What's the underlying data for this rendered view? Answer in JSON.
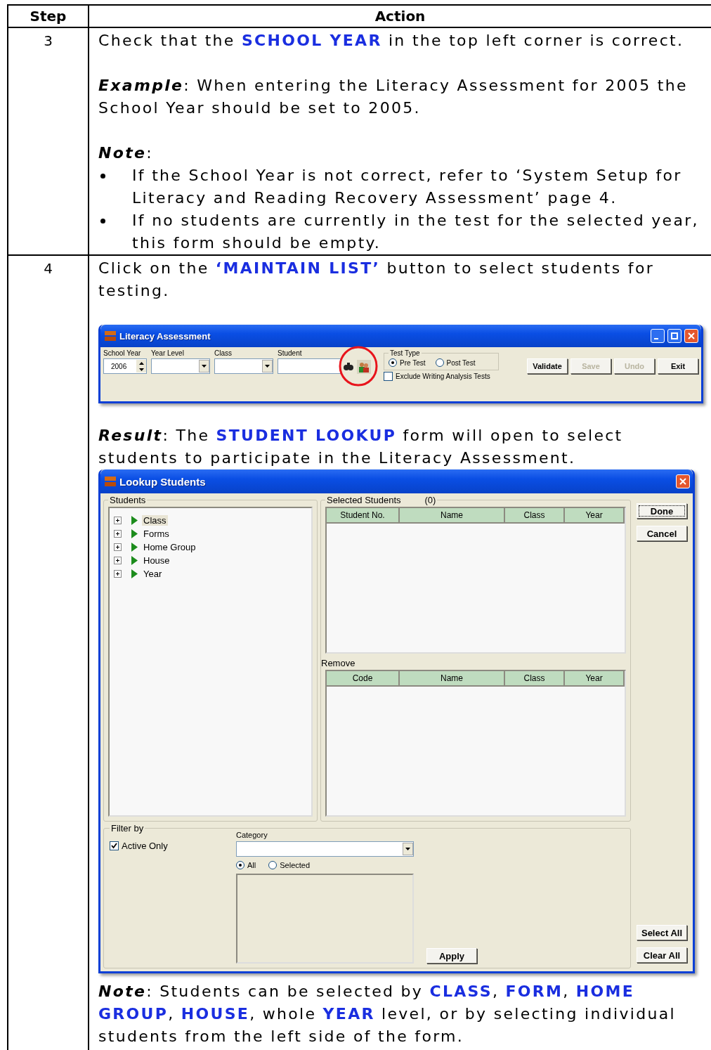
{
  "table": {
    "columns": [
      "Step",
      "Action"
    ],
    "rows": [
      {
        "step": "3",
        "blocks": [
          {
            "kind": "para",
            "text": "Check that the **SCHOOL YEAR** in the top left corner is correct."
          },
          {
            "kind": "para",
            "lead": "Example",
            "text": ": When entering the Literacy Assessment for 2005 the School Year should be set to 2005."
          },
          {
            "kind": "para",
            "lead": "Note",
            "text": ":"
          },
          {
            "kind": "bullets",
            "items": [
              "If the School Year is not correct, refer to ‘System Setup for Literacy and Reading Recovery Assessment’ page 4.",
              "If no students are currently in the test for the selected year, this form should be empty."
            ]
          }
        ]
      },
      {
        "step": "4",
        "blocks": [
          {
            "kind": "para",
            "text": "Click on the **‘MAINTAIN LIST’** button to select students for testing."
          },
          {
            "kind": "toolbar_window",
            "title": "Literacy Assessment",
            "fields": [
              {
                "label": "School Year",
                "kind": "spinner",
                "value": "2006"
              },
              {
                "label": "Year Level",
                "kind": "combo"
              },
              {
                "label": "Class",
                "kind": "combo"
              },
              {
                "label": "Student",
                "kind": "text"
              }
            ],
            "test_type": {
              "label": "Test Type",
              "options": [
                {
                  "label": "Pre Test",
                  "selected": true
                },
                {
                  "label": "Post Test",
                  "selected": false
                }
              ]
            },
            "exclude": {
              "label": "Exclude Writing Analysis Tests",
              "checked": false
            },
            "buttons": [
              {
                "label": "Validate",
                "disabled": false
              },
              {
                "label": "Save",
                "disabled": true
              },
              {
                "label": "Undo",
                "disabled": true
              },
              {
                "label": "Exit",
                "disabled": false
              }
            ]
          },
          {
            "kind": "para",
            "lead": "Result",
            "text": ":   The **STUDENT LOOKUP** form will open to select students to participate in the Literacy Assessment."
          },
          {
            "kind": "lookup_window",
            "title": "Lookup Students",
            "students": {
              "label": "Students",
              "items": [
                {
                  "label": "Class",
                  "selected": true,
                  "expanded": false
                },
                {
                  "label": "Forms",
                  "selected": false,
                  "expanded": false
                },
                {
                  "label": "Home Group",
                  "selected": false,
                  "expanded": false
                },
                {
                  "label": "House",
                  "selected": false,
                  "expanded": false
                },
                {
                  "label": "Year",
                  "selected": false,
                  "expanded": false
                }
              ]
            },
            "selected_students": {
              "label": "Selected Students",
              "count": "(0)",
              "columns": [
                "Student No.",
                "Name",
                "Class",
                "Year"
              ]
            },
            "remove": {
              "label": "Remove",
              "columns": [
                "Code",
                "Name",
                "Class",
                "Year"
              ]
            },
            "filter": {
              "label": "Filter by",
              "active_only": {
                "label": "Active Only",
                "checked": true
              },
              "category_label": "Category",
              "options": [
                {
                  "label": "All",
                  "selected": true
                },
                {
                  "label": "Selected",
                  "selected": false
                }
              ],
              "apply": "Apply"
            },
            "buttons_top": [
              "Done",
              "Cancel"
            ],
            "buttons_bottom": [
              "Select All",
              "Clear All"
            ]
          },
          {
            "kind": "para",
            "lead": "Note",
            "text": ": Students can be selected by **CLASS**, **FORM**, **HOME GROUP**, **HOUSE**, whole **YEAR** level, or by selecting individual students from the left side of the form."
          }
        ]
      }
    ]
  }
}
